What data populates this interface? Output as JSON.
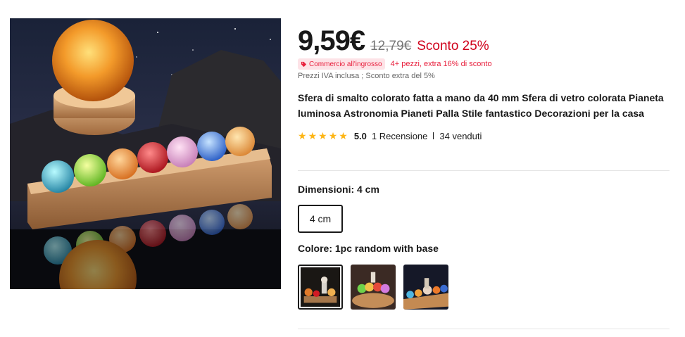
{
  "product": {
    "image_alt": "product-image",
    "price": {
      "current": "9,59€",
      "original": "12,79€",
      "discount": "Sconto 25%"
    },
    "promo": {
      "badge": "Commercio all'ingrosso",
      "text": "4+ pezzi, extra 16% di sconto"
    },
    "vat_note": "Prezzi IVA inclusa ; Sconto extra del 5%",
    "title": "Sfera di smalto colorato fatta a mano da 40 mm Sfera di vetro colorata Pianeta luminosa Astronomia Pianeti Palla Stile fantastico Decorazioni per la casa",
    "rating": {
      "stars": 5,
      "score": "5.0",
      "reviews": "1 Recensione",
      "sold": "34 venduti"
    },
    "dimensions": {
      "label": "Dimensioni: 4 cm",
      "options": [
        "4 cm"
      ],
      "selected": "4 cm"
    },
    "color": {
      "label": "Colore: 1pc random with base",
      "options": [
        "1pc random with base",
        "variant-2",
        "variant-3"
      ],
      "selected_index": 0
    }
  },
  "colors": {
    "accent_red": "#d0021b",
    "badge_bg": "#fde3e7",
    "badge_text": "#e81f3c",
    "star": "#fdb515"
  }
}
